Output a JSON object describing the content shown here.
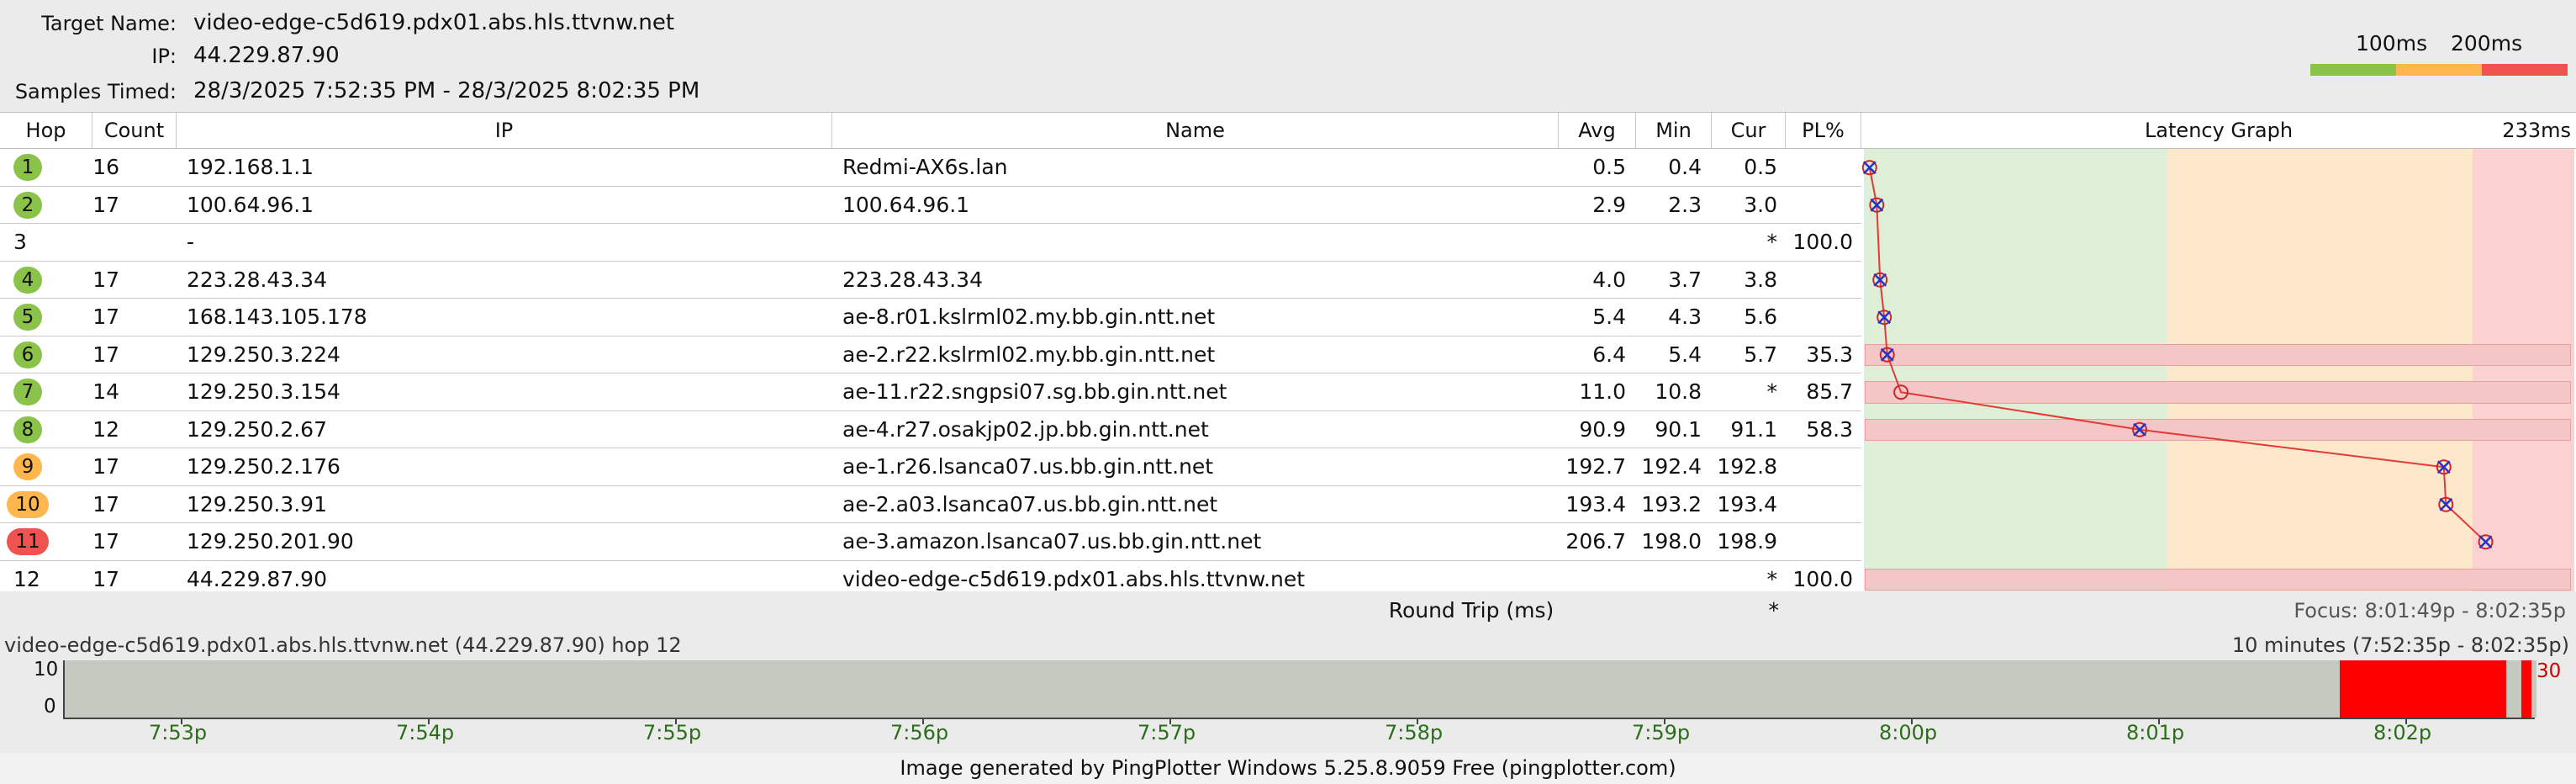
{
  "header": {
    "target_label": "Target Name:",
    "target_value": "video-edge-c5d619.pdx01.abs.hls.ttvnw.net",
    "ip_label": "IP:",
    "ip_value": "44.229.87.90",
    "samples_label": "Samples Timed:",
    "samples_value": "28/3/2025 7:52:35 PM - 28/3/2025 8:02:35 PM"
  },
  "legend": {
    "label_100": "100ms",
    "label_200": "200ms",
    "colors": [
      "#8bc34a",
      "#ffb74d",
      "#ef5350"
    ]
  },
  "columns": {
    "hop": "Hop",
    "count": "Count",
    "ip": "IP",
    "name": "Name",
    "avg": "Avg",
    "min": "Min",
    "cur": "Cur",
    "pl": "PL%",
    "graph": "Latency Graph",
    "graph_max": "233ms"
  },
  "hops": [
    {
      "hop": "1",
      "count": "16",
      "ip": "192.168.1.1",
      "name": "Redmi-AX6s.lan",
      "avg": "0.5",
      "min": "0.4",
      "cur": "0.5",
      "pl": "",
      "badge": "green",
      "latency": 0.5,
      "pl_pct": 0
    },
    {
      "hop": "2",
      "count": "17",
      "ip": "100.64.96.1",
      "name": "100.64.96.1",
      "avg": "2.9",
      "min": "2.3",
      "cur": "3.0",
      "pl": "",
      "badge": "green",
      "latency": 2.9,
      "pl_pct": 0
    },
    {
      "hop": "3",
      "count": "",
      "ip": "-",
      "name": "",
      "avg": "",
      "min": "",
      "cur": "*",
      "pl": "100.0",
      "badge": "none",
      "latency": null,
      "pl_pct": 0
    },
    {
      "hop": "4",
      "count": "17",
      "ip": "223.28.43.34",
      "name": "223.28.43.34",
      "avg": "4.0",
      "min": "3.7",
      "cur": "3.8",
      "pl": "",
      "badge": "green",
      "latency": 4.0,
      "pl_pct": 0
    },
    {
      "hop": "5",
      "count": "17",
      "ip": "168.143.105.178",
      "name": "ae-8.r01.kslrml02.my.bb.gin.ntt.net",
      "avg": "5.4",
      "min": "4.3",
      "cur": "5.6",
      "pl": "",
      "badge": "green",
      "latency": 5.4,
      "pl_pct": 0
    },
    {
      "hop": "6",
      "count": "17",
      "ip": "129.250.3.224",
      "name": "ae-2.r22.kslrml02.my.bb.gin.ntt.net",
      "avg": "6.4",
      "min": "5.4",
      "cur": "5.7",
      "pl": "35.3",
      "badge": "green",
      "latency": 6.4,
      "pl_pct": 35.3
    },
    {
      "hop": "7",
      "count": "14",
      "ip": "129.250.3.154",
      "name": "ae-11.r22.sngpsi07.sg.bb.gin.ntt.net",
      "avg": "11.0",
      "min": "10.8",
      "cur": "*",
      "pl": "85.7",
      "badge": "green",
      "latency": 11.0,
      "pl_pct": 85.7
    },
    {
      "hop": "8",
      "count": "12",
      "ip": "129.250.2.67",
      "name": "ae-4.r27.osakjp02.jp.bb.gin.ntt.net",
      "avg": "90.9",
      "min": "90.1",
      "cur": "91.1",
      "pl": "58.3",
      "badge": "green",
      "latency": 90.9,
      "pl_pct": 58.3
    },
    {
      "hop": "9",
      "count": "17",
      "ip": "129.250.2.176",
      "name": "ae-1.r26.lsanca07.us.bb.gin.ntt.net",
      "avg": "192.7",
      "min": "192.4",
      "cur": "192.8",
      "pl": "",
      "badge": "orange",
      "latency": 192.7,
      "pl_pct": 0
    },
    {
      "hop": "10",
      "count": "17",
      "ip": "129.250.3.91",
      "name": "ae-2.a03.lsanca07.us.bb.gin.ntt.net",
      "avg": "193.4",
      "min": "193.2",
      "cur": "193.4",
      "pl": "",
      "badge": "orange",
      "latency": 193.4,
      "pl_pct": 0
    },
    {
      "hop": "11",
      "count": "17",
      "ip": "129.250.201.90",
      "name": "ae-3.amazon.lsanca07.us.bb.gin.ntt.net",
      "avg": "206.7",
      "min": "198.0",
      "cur": "198.9",
      "pl": "",
      "badge": "red",
      "latency": 206.7,
      "pl_pct": 0
    },
    {
      "hop": "12",
      "count": "17",
      "ip": "44.229.87.90",
      "name": "video-edge-c5d619.pdx01.abs.hls.ttvnw.net",
      "avg": "",
      "min": "",
      "cur": "*",
      "pl": "100.0",
      "badge": "none",
      "latency": null,
      "pl_pct": 100
    }
  ],
  "roundtrip": {
    "label": "Round Trip (ms)",
    "cur": "*",
    "focus": "Focus: 8:01:49p - 8:02:35p"
  },
  "timeline": {
    "target": "video-edge-c5d619.pdx01.abs.hls.ttvnw.net (44.229.87.90) hop 12",
    "range": "10 minutes (7:52:35p - 8:02:35p)",
    "y_top": "10",
    "y_bottom": "0",
    "pl_max": "30",
    "ticks": [
      "7:53p",
      "7:54p",
      "7:55p",
      "7:56p",
      "7:57p",
      "7:58p",
      "7:59p",
      "8:00p",
      "8:01p",
      "8:02p"
    ]
  },
  "footer": "Image generated by PingPlotter Windows 5.25.8.9059 Free (pingplotter.com)"
}
